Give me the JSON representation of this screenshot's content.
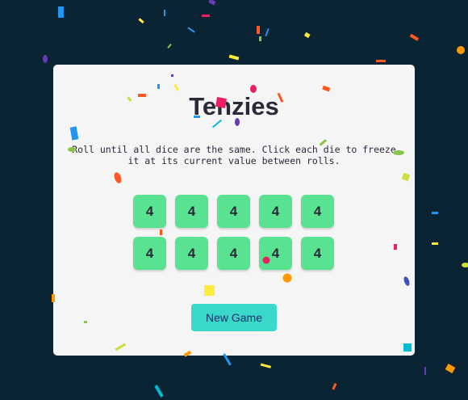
{
  "game": {
    "title": "Tenzies",
    "instructions": "Roll until all dice are the same. Click each die to freeze it at its current value between rolls.",
    "dice": [
      4,
      4,
      4,
      4,
      4,
      4,
      4,
      4,
      4,
      4
    ],
    "button_label": "New Game",
    "status": "won"
  },
  "colors": {
    "background": "#0b2434",
    "card": "#f5f5f5",
    "die_held": "#59e391",
    "button": "#3ad8cb",
    "confetti": [
      "#e91e63",
      "#2196f3",
      "#ff9800",
      "#ffeb3b",
      "#8bc34a",
      "#ff5722",
      "#00bcd4",
      "#673ab7",
      "#cddc39"
    ]
  }
}
